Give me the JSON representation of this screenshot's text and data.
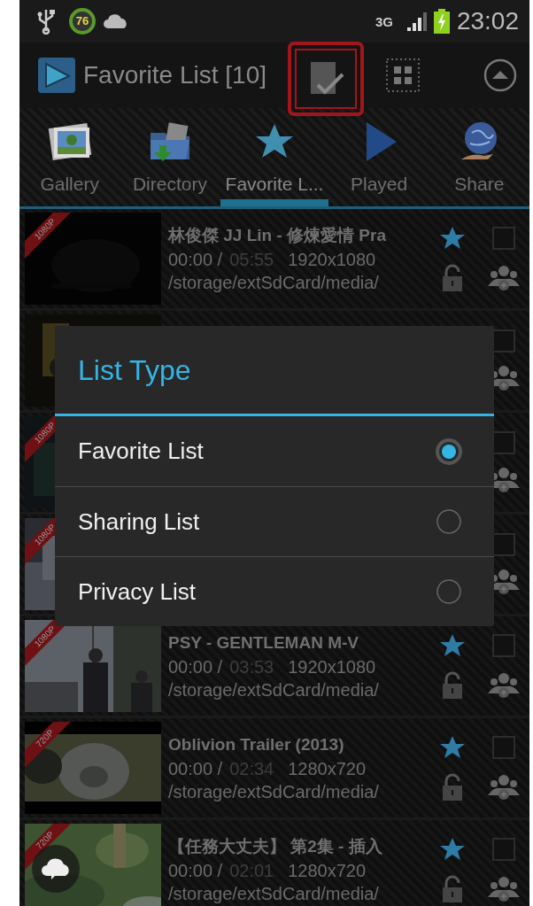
{
  "status_bar": {
    "battery_badge": "76",
    "network": "3G",
    "time": "23:02"
  },
  "action_bar": {
    "title": "Favorite List [10]"
  },
  "tabs": [
    {
      "label": "Gallery",
      "selected": false
    },
    {
      "label": "Directory",
      "selected": false
    },
    {
      "label": "Favorite L...",
      "selected": true
    },
    {
      "label": "Played",
      "selected": false
    },
    {
      "label": "Share",
      "selected": false
    }
  ],
  "videos": [
    {
      "title": "林俊傑 JJ Lin - 修煉愛情 Pra",
      "position": "00:00 /",
      "duration": "05:55",
      "resolution": "1920x1080",
      "path": "/storage/extSdCard/media/",
      "quality": "1080P",
      "favorite": true,
      "checked": false
    },
    {
      "checked": false
    },
    {
      "quality": "1080P",
      "checked": false
    },
    {
      "quality": "1080P",
      "checked": false
    },
    {
      "title": "PSY - GENTLEMAN M-V",
      "position": "00:00 /",
      "duration": "03:53",
      "resolution": "1920x1080",
      "path": "/storage/extSdCard/media/",
      "quality": "1080P",
      "favorite": true,
      "checked": false
    },
    {
      "title": "Oblivion Trailer (2013)",
      "position": "00:00 /",
      "duration": "02:34",
      "resolution": "1280x720",
      "path": "/storage/extSdCard/media/",
      "quality": "720P",
      "favorite": true,
      "checked": false
    },
    {
      "title": "【任務大丈夫】 第2集 - 插入",
      "position": "00:00 /",
      "duration": "02:01",
      "resolution": "1280x720",
      "path": "/storage/extSdCard/media/",
      "quality": "720P",
      "favorite": true,
      "checked": false
    }
  ],
  "dialog": {
    "title": "List Type",
    "options": [
      {
        "label": "Favorite List",
        "selected": true
      },
      {
        "label": "Sharing List",
        "selected": false
      },
      {
        "label": "Privacy List",
        "selected": false
      }
    ]
  }
}
